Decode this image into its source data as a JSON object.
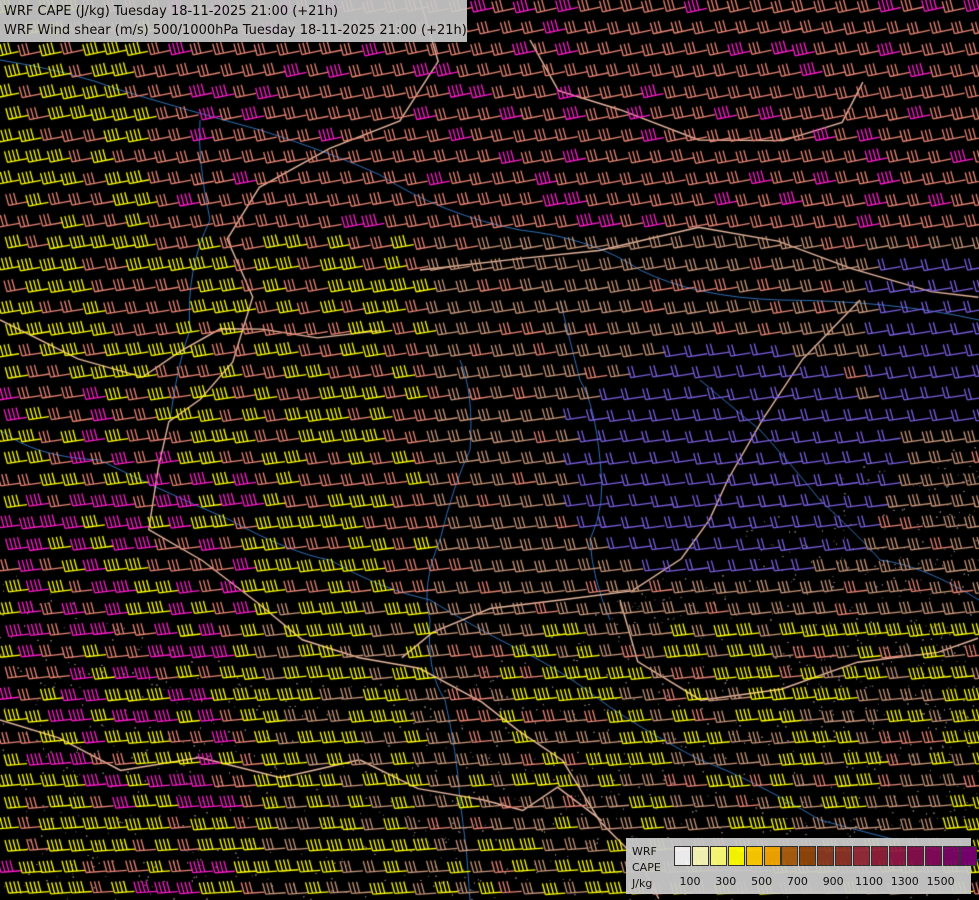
{
  "header": {
    "line1": "WRF CAPE (J/kg) Tuesday 18-11-2025 21:00 (+21h)",
    "line2": "WRF Wind shear (m/s) 500/1000hPa Tuesday 18-11-2025 21:00 (+21h)"
  },
  "legend": {
    "label_top": "WRF",
    "label_mid": "CAPE",
    "label_unit": "J/kg",
    "swatch_colors": [
      "#f7f7f7",
      "#fbfbbb",
      "#ffff7a",
      "#ffff00",
      "#ffcc00",
      "#f5a700",
      "#a95e10",
      "#91460b",
      "#8b3a22",
      "#8d3328",
      "#962c39",
      "#8f1f3a",
      "#8f1946",
      "#850f4c",
      "#820a5a",
      "#7b0766",
      "#7a0170"
    ],
    "ticks": [
      "100",
      "300",
      "500",
      "700",
      "900",
      "1100",
      "1300",
      "1500"
    ]
  },
  "map": {
    "barb_colors": {
      "weak": "#7a5fe0",
      "light": "#c8967a",
      "moderate": "#e98574",
      "strong": "#ffff00",
      "very_strong": "#ff1ccc"
    },
    "border_color": "#e8b8a0",
    "river_color": "#2f6fb8",
    "cape_dots_color": "#7a6a6a"
  }
}
